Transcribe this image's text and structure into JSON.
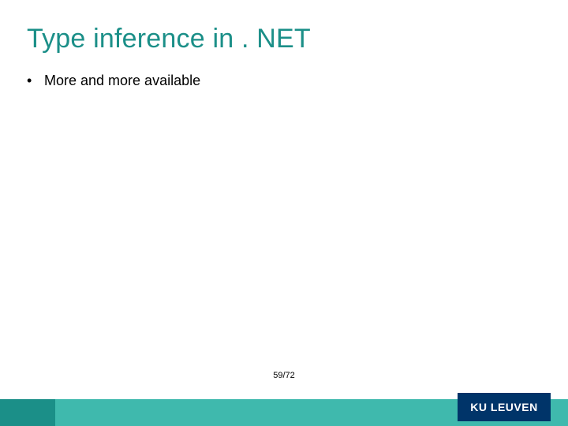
{
  "title": "Type inference in . NET",
  "bullets": [
    {
      "text": "More and more available"
    }
  ],
  "page": "59/72",
  "brand": "KU LEUVEN"
}
